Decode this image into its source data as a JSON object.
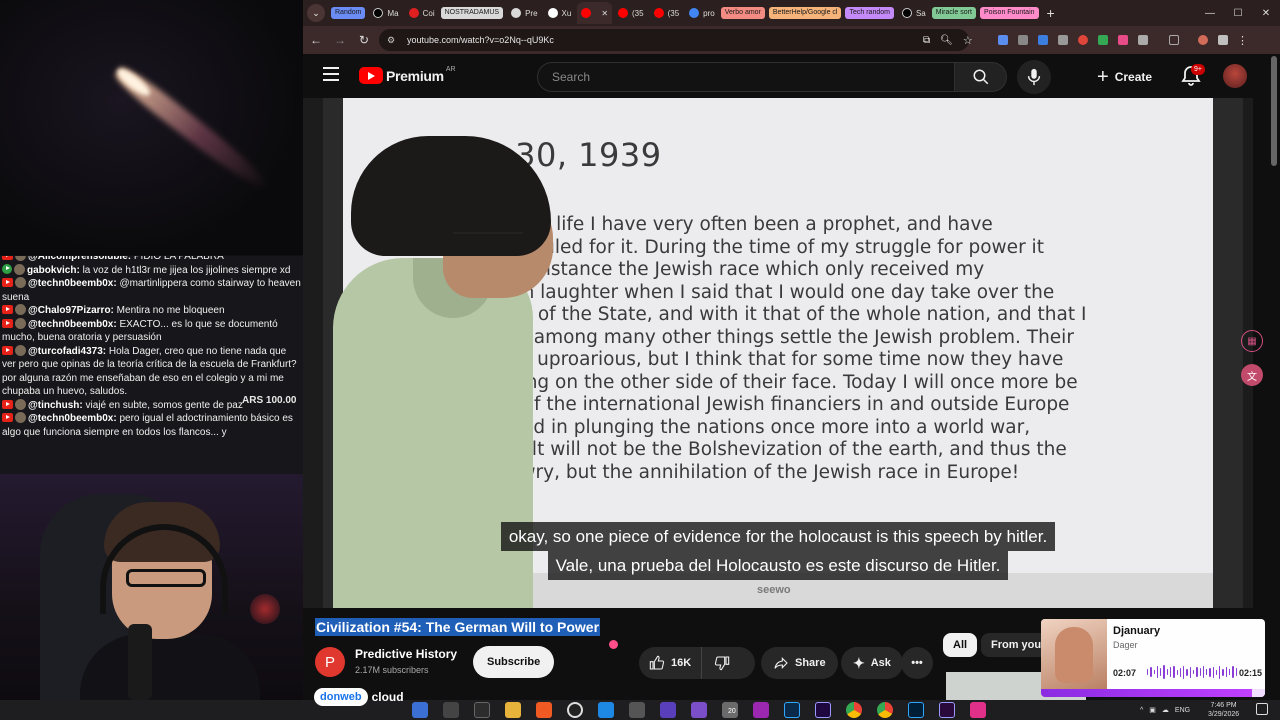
{
  "browser": {
    "tabs": [
      {
        "label": "Random",
        "type": "group",
        "color": "#6b8cf5"
      },
      {
        "label": "Ma",
        "type": "tab",
        "icon": "x-icon"
      },
      {
        "label": "Coi",
        "type": "tab",
        "icon": "red-icon"
      },
      {
        "label": "NOSTRADAMUS",
        "type": "group",
        "color": "#d9d9d9"
      },
      {
        "label": "Pre",
        "type": "tab",
        "icon": "chatgpt-icon"
      },
      {
        "label": "Xu",
        "type": "tab",
        "icon": "chat-icon"
      },
      {
        "label": "",
        "type": "active",
        "icon": "youtube-icon"
      },
      {
        "label": "(35",
        "type": "tab",
        "icon": "youtube-icon"
      },
      {
        "label": "(35",
        "type": "tab",
        "icon": "youtube-icon"
      },
      {
        "label": "pro",
        "type": "tab",
        "icon": "google-icon"
      },
      {
        "label": "Verbo amor",
        "type": "group",
        "color": "#f28b82"
      },
      {
        "label": "BetterHelp/Google cl",
        "type": "group",
        "color": "#f7b47a"
      },
      {
        "label": "Tech random",
        "type": "group",
        "color": "#c58af9"
      },
      {
        "label": "Sa",
        "type": "tab",
        "icon": "x-icon"
      },
      {
        "label": "Miracle sort",
        "type": "group",
        "color": "#81c995"
      },
      {
        "label": "Poison Fountain",
        "type": "group",
        "color": "#ff8bcb"
      }
    ],
    "new_tab": "+",
    "url": "youtube.com/watch?v=o2Nq--qU9Kc"
  },
  "youtube": {
    "logo_text": "Premium",
    "country": "AR",
    "search_placeholder": "Search",
    "create_label": "Create",
    "notif_count": "9+",
    "video_title": "Civilization #54: The German Will to Power",
    "channel_name": "Predictive History",
    "channel_initial": "P",
    "channel_subs": "2.17M subscribers",
    "subscribe_label": "Subscribe",
    "likes": "16K",
    "share_label": "Share",
    "ask_label": "Ask",
    "chips": [
      "All",
      "From your"
    ],
    "subtitles": [
      "okay, so one piece of evidence for the holocaust is this speech by hitler.",
      "Vale, una prueba del Holocausto es este discurso de Hitler."
    ]
  },
  "slide": {
    "date": "y 30, 1939",
    "lines": [
      "rse of my life I have very often been a prophet, and have",
      "een ridiculed for it. During the time of my struggle for power it",
      "he first instance the Jewish race which only received my",
      "ies with laughter when I said that I would one day take over the",
      "dership of the State, and with it that of the whole nation, and that I",
      "ld then among many other things settle the Jewish problem. Their",
      "ter was uproarious, but I think that for some time now they have",
      " laughing on the other side of their face. Today I will once more be",
      "ophet: If the international Jewish financiers in and outside Europe",
      " succeed in plunging the nations once more into a world war,",
      "he result will not be the Bolshevization of the earth, and thus the",
      "y of Jewry, but the annihilation of the Jewish race in Europe!"
    ],
    "brand": "seewo"
  },
  "chat": {
    "lines": [
      {
        "user": "@Allcomprensoluble:",
        "text": "PIDIO LA PALABRA",
        "badge": "red"
      },
      {
        "user": "gabokvich:",
        "text": "la voz de h1tl3r me jijea los jijolines siempre xd",
        "badge": "green"
      },
      {
        "user": "@techn0beemb0x:",
        "text": "@martinlippera como stairway to heaven suena",
        "badge": "red"
      },
      {
        "user": "@Chalo97Pizarro:",
        "text": "Mentira no me bloqueen",
        "badge": "red"
      },
      {
        "user": "@techn0beemb0x:",
        "text": "EXACTO... es lo que se documentó mucho, buena oratoria y persuasión",
        "badge": "red"
      },
      {
        "user": "@turcofadi4373:",
        "text": "Hola Dager, creo que no tiene nada que ver pero que opinas de la teoría crítica de la escuela de Frankfurt? por alguna razón me enseñaban de eso en el colegio y a mi me chupaba un huevo, saludos.",
        "badge": "red"
      },
      {
        "user": "@tinchush:",
        "text": "viajé en subte, somos gente de paz",
        "badge": "red"
      },
      {
        "user": "@techn0beemb0x:",
        "text": "pero igual el adoctrinamiento básico es algo que funciona siempre en todos los flancos... y",
        "badge": "red"
      }
    ],
    "tip": "ARS 100.00"
  },
  "mini_player": {
    "title": "Djanuary",
    "artist": "Dager",
    "current": "02:07",
    "total": "02:15",
    "progress": 0.94
  },
  "sponsor": {
    "name": "donweb",
    "suffix": "cloud"
  },
  "taskbar": {
    "lang": "ENG",
    "time": "7:46 PM",
    "date": "3/29/2026",
    "badge": "20"
  }
}
